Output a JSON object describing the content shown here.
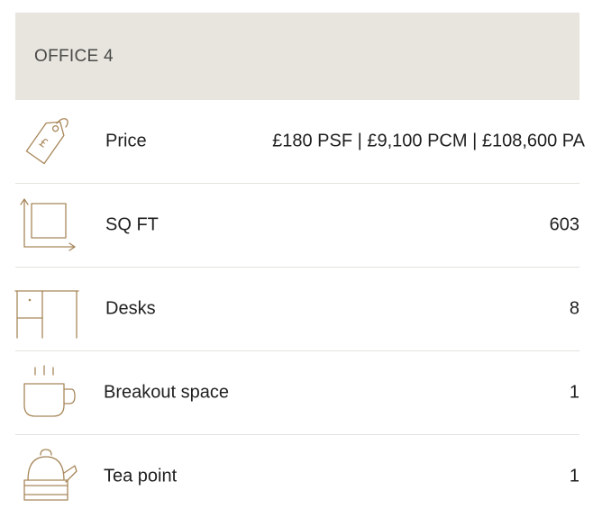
{
  "office": {
    "title": "OFFICE 4",
    "rows": [
      {
        "icon": "price-tag-icon",
        "label": "Price",
        "value": "£180 PSF | £9,100 PCM | £108,600 PA"
      },
      {
        "icon": "floor-area-icon",
        "label": "SQ FT",
        "value": "603"
      },
      {
        "icon": "desk-icon",
        "label": "Desks",
        "value": "8"
      },
      {
        "icon": "coffee-cup-icon",
        "label": "Breakout space",
        "value": "1"
      },
      {
        "icon": "kettle-icon",
        "label": "Tea point",
        "value": "1"
      }
    ]
  },
  "colors": {
    "header_bg": "#e7e5de",
    "icon_accent": "#a8875a",
    "divider": "#e4e2dc"
  }
}
